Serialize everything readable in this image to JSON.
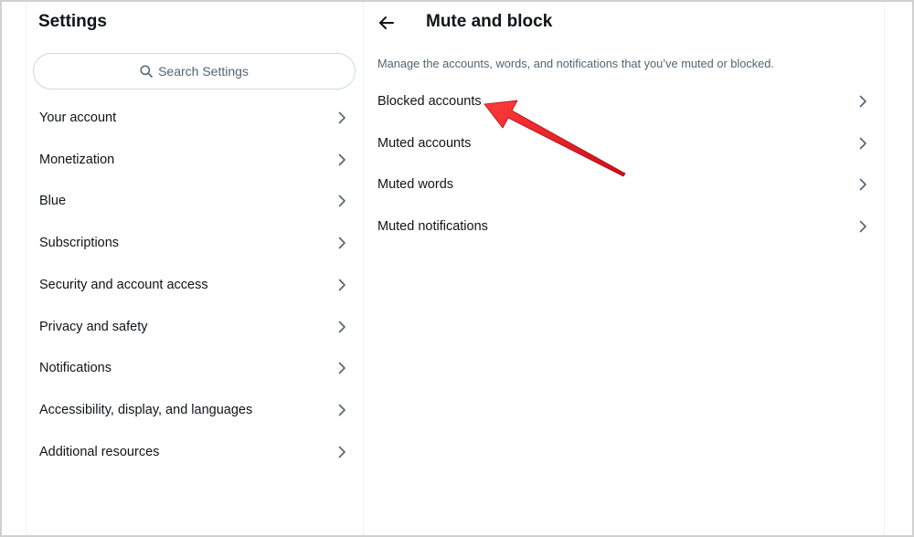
{
  "settings": {
    "title": "Settings",
    "search_placeholder": "Search Settings",
    "items": [
      {
        "label": "Your account"
      },
      {
        "label": "Monetization"
      },
      {
        "label": "Blue"
      },
      {
        "label": "Subscriptions"
      },
      {
        "label": "Security and account access"
      },
      {
        "label": "Privacy and safety"
      },
      {
        "label": "Notifications"
      },
      {
        "label": "Accessibility, display, and languages"
      },
      {
        "label": "Additional resources"
      }
    ]
  },
  "main": {
    "title": "Mute and block",
    "description": "Manage the accounts, words, and notifications that you’ve muted or blocked.",
    "options": [
      {
        "label": "Blocked accounts"
      },
      {
        "label": "Muted accounts"
      },
      {
        "label": "Muted words"
      },
      {
        "label": "Muted notifications"
      }
    ]
  },
  "icons": {
    "back": "arrow-left-icon",
    "search": "search-icon",
    "chevron": "chevron-right-icon",
    "annotation": "red-arrow-pointer"
  },
  "colors": {
    "text_primary": "#0f1419",
    "text_secondary": "#536471",
    "annotation_red": "#e8141c"
  }
}
